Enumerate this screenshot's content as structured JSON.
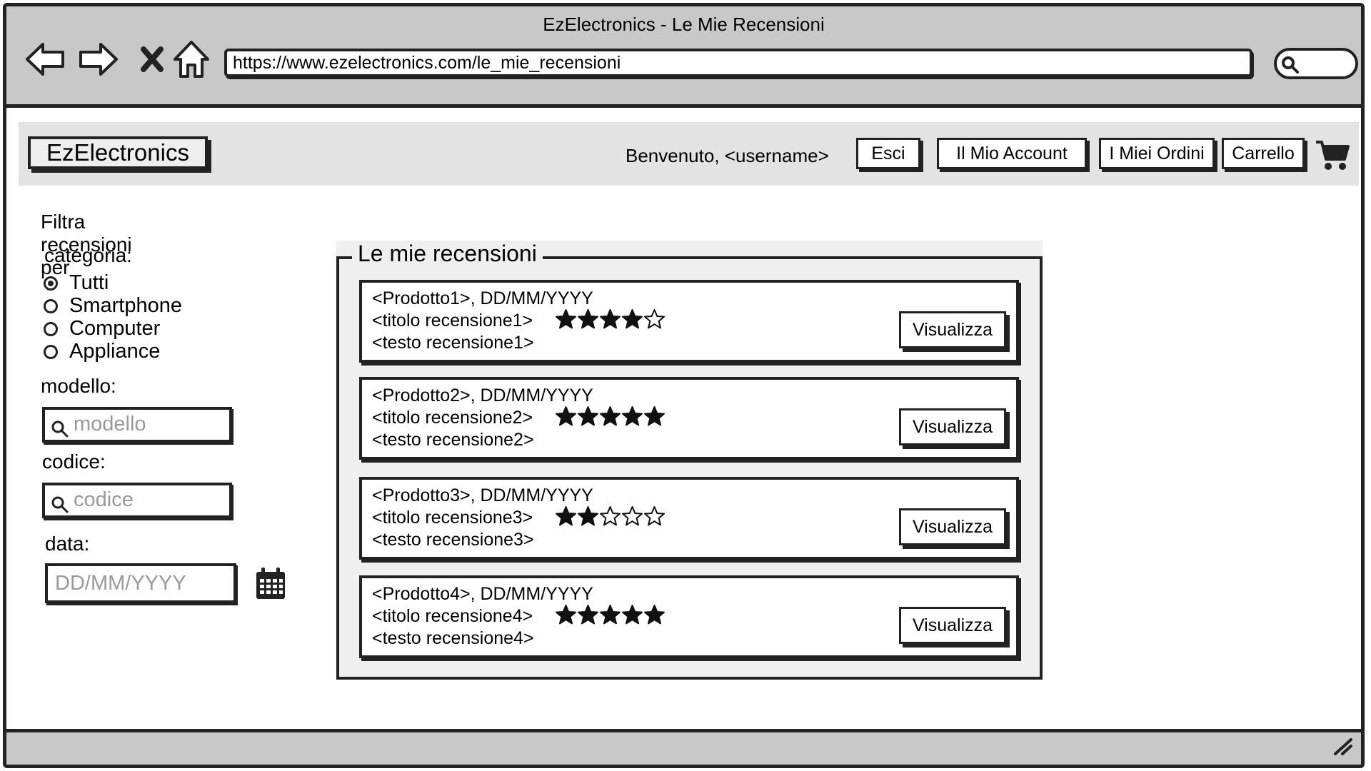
{
  "browser": {
    "title": "EzElectronics - Le Mie Recensioni",
    "url": "https://www.ezelectronics.com/le_mie_recensioni"
  },
  "header": {
    "logo": "EzElectronics",
    "welcome": "Benvenuto, <username>",
    "logout": "Esci",
    "account": "Il Mio Account",
    "orders": "I Miei Ordini",
    "cart": "Carrello"
  },
  "filters": {
    "title": "Filtra recensioni per",
    "category_label": "categoria:",
    "categories": [
      {
        "label": "Tutti",
        "selected": true
      },
      {
        "label": "Smartphone",
        "selected": false
      },
      {
        "label": "Computer",
        "selected": false
      },
      {
        "label": "Appliance",
        "selected": false
      }
    ],
    "model_label": "modello:",
    "model_placeholder": "modello",
    "code_label": "codice:",
    "code_placeholder": "codice",
    "date_label": "data:",
    "date_placeholder": "DD/MM/YYYY"
  },
  "reviews_section": {
    "title": "Le mie recensioni",
    "view_label": "Visualizza",
    "reviews": [
      {
        "product": "<Prodotto1>, DD/MM/YYYY",
        "title": "<titolo recensione1>",
        "text": "<testo recensione1>",
        "rating": 4,
        "max_rating": 5
      },
      {
        "product": "<Prodotto2>, DD/MM/YYYY",
        "title": "<titolo recensione2>",
        "text": "<testo recensione2>",
        "rating": 5,
        "max_rating": 5
      },
      {
        "product": "<Prodotto3>, DD/MM/YYYY",
        "title": "<titolo recensione3>",
        "text": "<testo recensione3>",
        "rating": 2,
        "max_rating": 5
      },
      {
        "product": "<Prodotto4>, DD/MM/YYYY",
        "title": "<titolo recensione4>",
        "text": "<testo recensione4>",
        "rating": 5,
        "max_rating": 5
      }
    ]
  },
  "icons": {
    "back": "back-arrow-icon",
    "forward": "forward-arrow-icon",
    "stop": "close-icon",
    "home": "home-icon",
    "search": "search-icon",
    "cart": "cart-icon",
    "calendar": "calendar-icon",
    "star_filled": "star-filled-icon",
    "star_empty": "star-empty-icon",
    "resize": "resize-grip-icon"
  },
  "colors": {
    "chrome": "#c8c8c8",
    "header_bg": "#e3e3e3",
    "panel_bg": "#efefef",
    "ink": "#222222",
    "placeholder": "#999999"
  }
}
